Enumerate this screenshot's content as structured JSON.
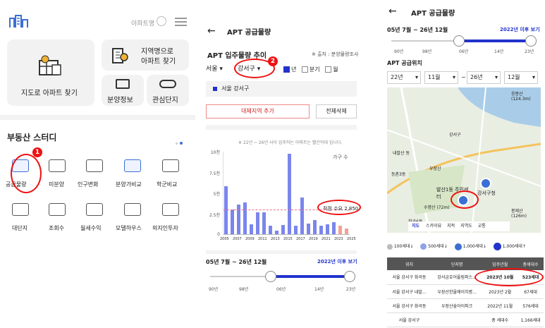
{
  "p1": {
    "search_label": "아파트명",
    "tiles": {
      "map": "지도로 아파트 찾기",
      "name_line1": "지역명으로",
      "name_line2": "아파트 찾기",
      "presale": "분양정보",
      "interest": "관심단지"
    },
    "study_title": "부동산 스터디",
    "grid": [
      "공급물량",
      "미분양",
      "인구변화",
      "분양가비교",
      "학군비교",
      "대단지",
      "조회수",
      "월세수익",
      "모델하우스",
      "외지인투자"
    ],
    "badge1": "1"
  },
  "p2": {
    "title": "APT 공급물량",
    "trend_title": "APT 입주물량 추이",
    "source": "※ 출처 : 분양물량조사",
    "city": "서울",
    "district": "강서구",
    "period_options": [
      "년",
      "분기",
      "월"
    ],
    "selected_region": "서울 강서구",
    "add_button": "대체지역 추가",
    "delete_all": "전체삭제",
    "note": "※ 22년 ~ 26년 사이 입주하는 아파트는 빨간막대 입니다.",
    "unit": "가구 수",
    "badge2": "2",
    "demand_label": "적정 수요 2,850",
    "range_text": "05년 7월 ~ 26년 12월",
    "after2022": "2022년 이후 보기",
    "slider_ticks": [
      "90년",
      "98년",
      "06년",
      "14년",
      "23년"
    ]
  },
  "p3": {
    "title": "APT 공급물량",
    "range_text": "05년 7월 ~ 26년 12월",
    "after2022": "2022년 이후 보기",
    "slider_ticks": [
      "90년",
      "98년",
      "06년",
      "14년",
      "23년"
    ],
    "location_title": "APT 공급위치",
    "from_year": "22년",
    "from_month": "11월",
    "to_year": "26년",
    "to_month": "12월",
    "map_labels": [
      "강서구청",
      "발산1동 주민센터",
      "수명산 (72m)",
      "강서구",
      "내발산 동",
      "우장산",
      "등촌3동",
      "화곡6동",
      "응봉산 (124.3m)",
      "봉제산 (126m)"
    ],
    "map_tabs": [
      "지도",
      "스카이뷰",
      "지적",
      "지역도",
      "교통"
    ],
    "legend": [
      "100세대",
      "500세대",
      "1,000세대",
      "1,000세대"
    ],
    "table": {
      "headers": [
        "위치",
        "단지명",
        "입주년월",
        "총세대수"
      ],
      "rows": [
        [
          "서울 강서구 화곡동",
          "강서금호어울림퍼스...",
          "2023년 10월",
          "523세대"
        ],
        [
          "서울 강서구 내발...",
          "우장산한울에이치병...",
          "2023년 2월",
          "67세대"
        ],
        [
          "서울 강서구 화곡동",
          "우장산숲아이파크",
          "2022년 11월",
          "576세대"
        ],
        [
          "서울 강서구",
          "",
          "총 세대수",
          "1,166세대"
        ]
      ]
    }
  },
  "chart_data": {
    "type": "bar",
    "title": "APT 입주물량 추이",
    "ylabel": "가구 수",
    "y_ticks": [
      "0",
      "2.5천",
      "5천",
      "7.5천",
      "10천"
    ],
    "ylim": [
      0,
      10000
    ],
    "x_ticks": [
      "2005",
      "2007",
      "2009",
      "2011",
      "2013",
      "2015",
      "2017",
      "2019",
      "2021",
      "2023",
      "2025"
    ],
    "x": [
      "2005-1",
      "2005-2",
      "2006-1",
      "2006-2",
      "2007-1",
      "2007-2",
      "2008-1",
      "2008-2",
      "2009-1",
      "2009-2",
      "2010-1",
      "2010-2",
      "2011-1",
      "2011-2",
      "2012-1",
      "2012-2",
      "2013-1",
      "2013-2",
      "2014-1",
      "2014-2",
      "2015-1",
      "2015-2",
      "2016-1",
      "2016-2",
      "2017-1",
      "2017-2",
      "2018-1",
      "2018-2",
      "2019-1",
      "2019-2",
      "2020-1",
      "2020-2",
      "2021-1",
      "2021-2",
      "2022-1",
      "2022-2",
      "2023-1",
      "2023-2",
      "2024-1",
      "2024-2"
    ],
    "values": [
      5800,
      0,
      3000,
      0,
      3600,
      0,
      3800,
      0,
      1200,
      0,
      2600,
      0,
      2600,
      0,
      1000,
      0,
      400,
      0,
      1100,
      0,
      9700,
      0,
      1000,
      0,
      4400,
      0,
      1300,
      0,
      1700,
      0,
      1000,
      0,
      1200,
      0,
      1400,
      0,
      1000,
      0,
      700,
      0
    ],
    "highlight_from_index": 36,
    "demand_line": 2850,
    "demand_label": "적정 수요 2,850",
    "colors": {
      "bar": "#7b86ec",
      "highlight": "#f4a093",
      "demand": "#e86f8b"
    }
  }
}
